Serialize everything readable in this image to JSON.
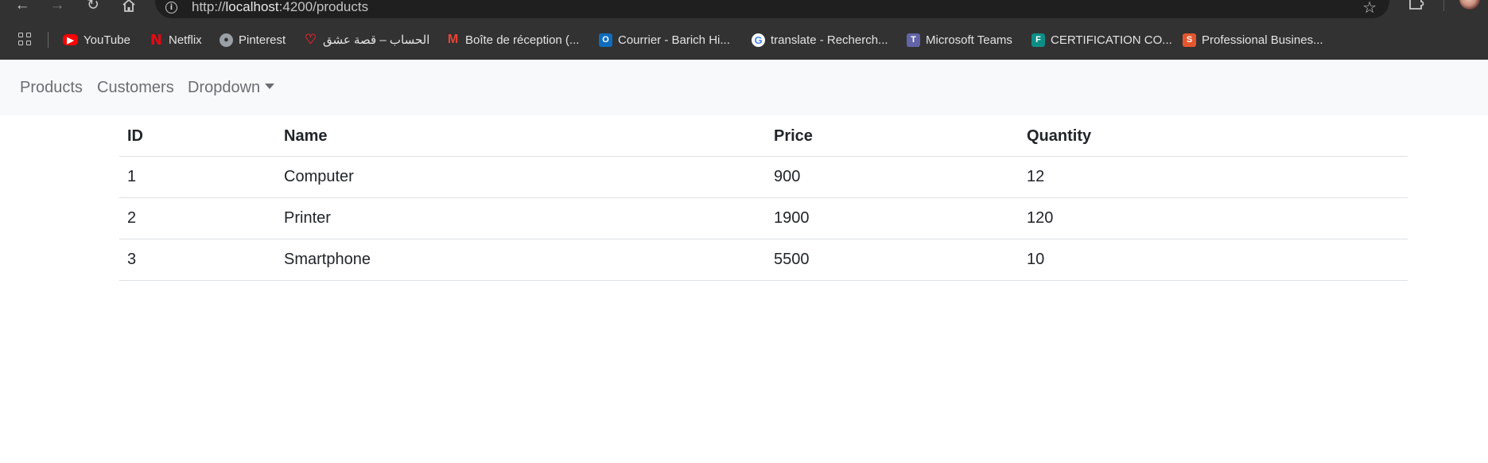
{
  "browser": {
    "url_scheme": "http://",
    "url_host": "localhost",
    "url_rest": ":4200/products",
    "bookmarks": [
      {
        "label": "YouTube",
        "icon": "youtube-icon",
        "color": "#ff0000"
      },
      {
        "label": "Netflix",
        "icon": "netflix-icon",
        "color": "#e50914"
      },
      {
        "label": "Pinterest",
        "icon": "globe-icon",
        "color": "#9aa0a6"
      },
      {
        "label": "الحساب – قصة عشق",
        "icon": "heart-icon",
        "color": "#d6242c"
      },
      {
        "label": "Boîte de réception (...",
        "icon": "gmail-icon",
        "color": "#ea4335"
      },
      {
        "label": "Courrier - Barich Hi...",
        "icon": "outlook-icon",
        "color": "#0f6cbd"
      },
      {
        "label": "translate - Recherch...",
        "icon": "google-icon",
        "color": "#4285f4"
      },
      {
        "label": "Microsoft Teams",
        "icon": "teams-icon",
        "color": "#6264a7"
      },
      {
        "label": "CERTIFICATION CO...",
        "icon": "forms-icon",
        "color": "#0c8e85"
      },
      {
        "label": "Professional Busines...",
        "icon": "s-icon",
        "color": "#e4572e"
      }
    ]
  },
  "navbar": {
    "items": [
      "Products",
      "Customers",
      "Dropdown"
    ]
  },
  "table": {
    "headers": [
      "ID",
      "Name",
      "Price",
      "Quantity"
    ],
    "rows": [
      [
        "1",
        "Computer",
        "900",
        "12"
      ],
      [
        "2",
        "Printer",
        "1900",
        "120"
      ],
      [
        "3",
        "Smartphone",
        "5500",
        "10"
      ]
    ]
  }
}
